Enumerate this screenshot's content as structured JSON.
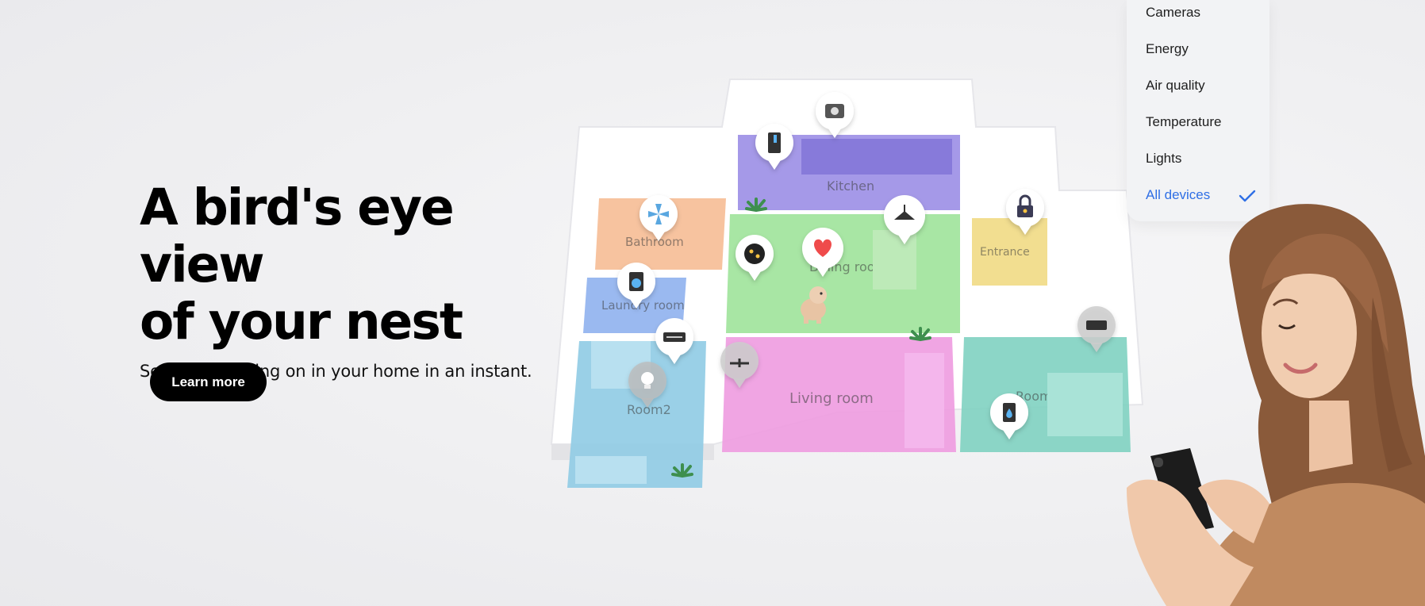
{
  "hero": {
    "title_line1": "A bird's eye view",
    "title_line2": "of your nest",
    "subtitle": "See what’s going on in your home in an instant.",
    "cta_label": "Learn more"
  },
  "floorplan": {
    "rooms": {
      "kitchen": "Kitchen",
      "bathroom": "Bathroom",
      "laundry": "Laundry room",
      "dining": "Dining room",
      "entrance": "Entrance",
      "living": "Living room",
      "bedroom2": "Room2",
      "study": "Room"
    },
    "colors": {
      "kitchen": "#9b8ee6",
      "bathroom": "#f6b98e",
      "laundry": "#8fb1ee",
      "dining": "#9fe39a",
      "entrance": "#f1dc8a",
      "living": "#ee9be0",
      "bedroom2": "#8fcbe4",
      "study": "#7fd1c1"
    }
  },
  "filter_menu": {
    "items": [
      {
        "label": "Cameras"
      },
      {
        "label": "Energy"
      },
      {
        "label": "Air quality"
      },
      {
        "label": "Temperature"
      },
      {
        "label": "Lights"
      },
      {
        "label": "All devices"
      }
    ],
    "selected": "All devices",
    "accent_color": "#2f6fe5"
  },
  "icons": {
    "device_pins": [
      "camera-icon",
      "fridge-icon",
      "fan-icon",
      "washer-icon",
      "air-conditioner-icon",
      "light-bulb-icon",
      "sensor-icon",
      "heart-icon",
      "ceiling-lamp-icon",
      "lock-icon",
      "air-purifier-icon",
      "water-icon"
    ],
    "check": "check-icon"
  }
}
